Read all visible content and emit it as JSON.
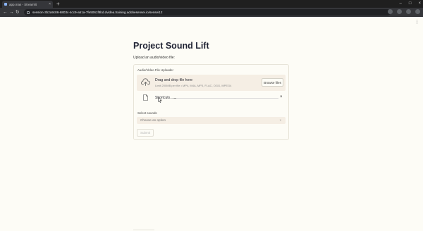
{
  "browser": {
    "tab_title": "app.mas - Streamlit",
    "tab_close": "×",
    "new_tab": "+",
    "window_buttons": [
      "–",
      "□",
      "×"
    ],
    "nav": {
      "back": "←",
      "forward": "→",
      "reload": "↻"
    },
    "url": "session-3b2a9c86-6803c-4cc9-a51a-7fe5061f8bd.dvidea.training.adobesensei.io/sensei12"
  },
  "page": {
    "menu": "⋮",
    "title": "Project Sound Lift",
    "subtitle": "Upload an audio/video file:"
  },
  "uploader": {
    "label": "Audio/Video File Uploader",
    "dropzone_text": "Drag and drop file here",
    "dropzone_hint": "Limit 200MB per file • MP4, M4A, MP3, FLAC, OGG, MPEG4",
    "browse_label": "Browse files",
    "file_name": "Shortcuts...",
    "close_symbol": "×",
    "progress": 0.03
  },
  "sounds": {
    "label": "Select sounds",
    "placeholder": "Choose an option",
    "chevron": "⌄"
  },
  "submit_label": "Submit"
}
